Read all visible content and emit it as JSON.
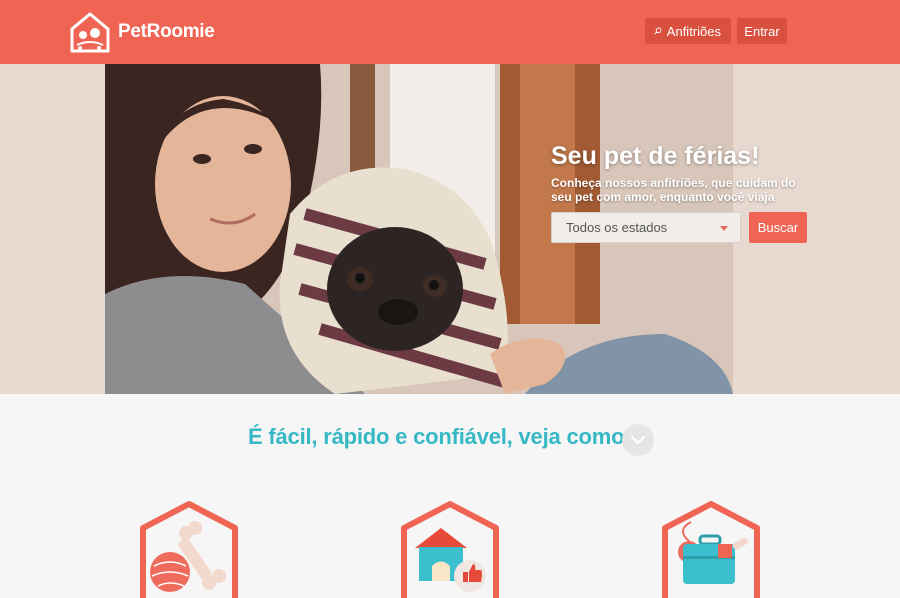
{
  "header": {
    "brand": "PetRoomie",
    "hosts_label": "Anfitriões",
    "login_label": "Entrar"
  },
  "hero": {
    "title": "Seu pet de férias!",
    "subtitle": "Conheça nossos anfitriões, que cuidam do seu pet com amor, enquanto você viaja",
    "state_select_value": "Todos os estados",
    "search_label": "Buscar"
  },
  "how": {
    "title": "É fácil, rápido e confiável, veja como."
  },
  "colors": {
    "brand": "#f06454",
    "accent": "#36b8c5"
  },
  "icons": [
    "logo-icon",
    "search-icon",
    "chevron-down-icon",
    "yarn-bone-icon",
    "dog-house-icon",
    "suitcase-icon"
  ]
}
